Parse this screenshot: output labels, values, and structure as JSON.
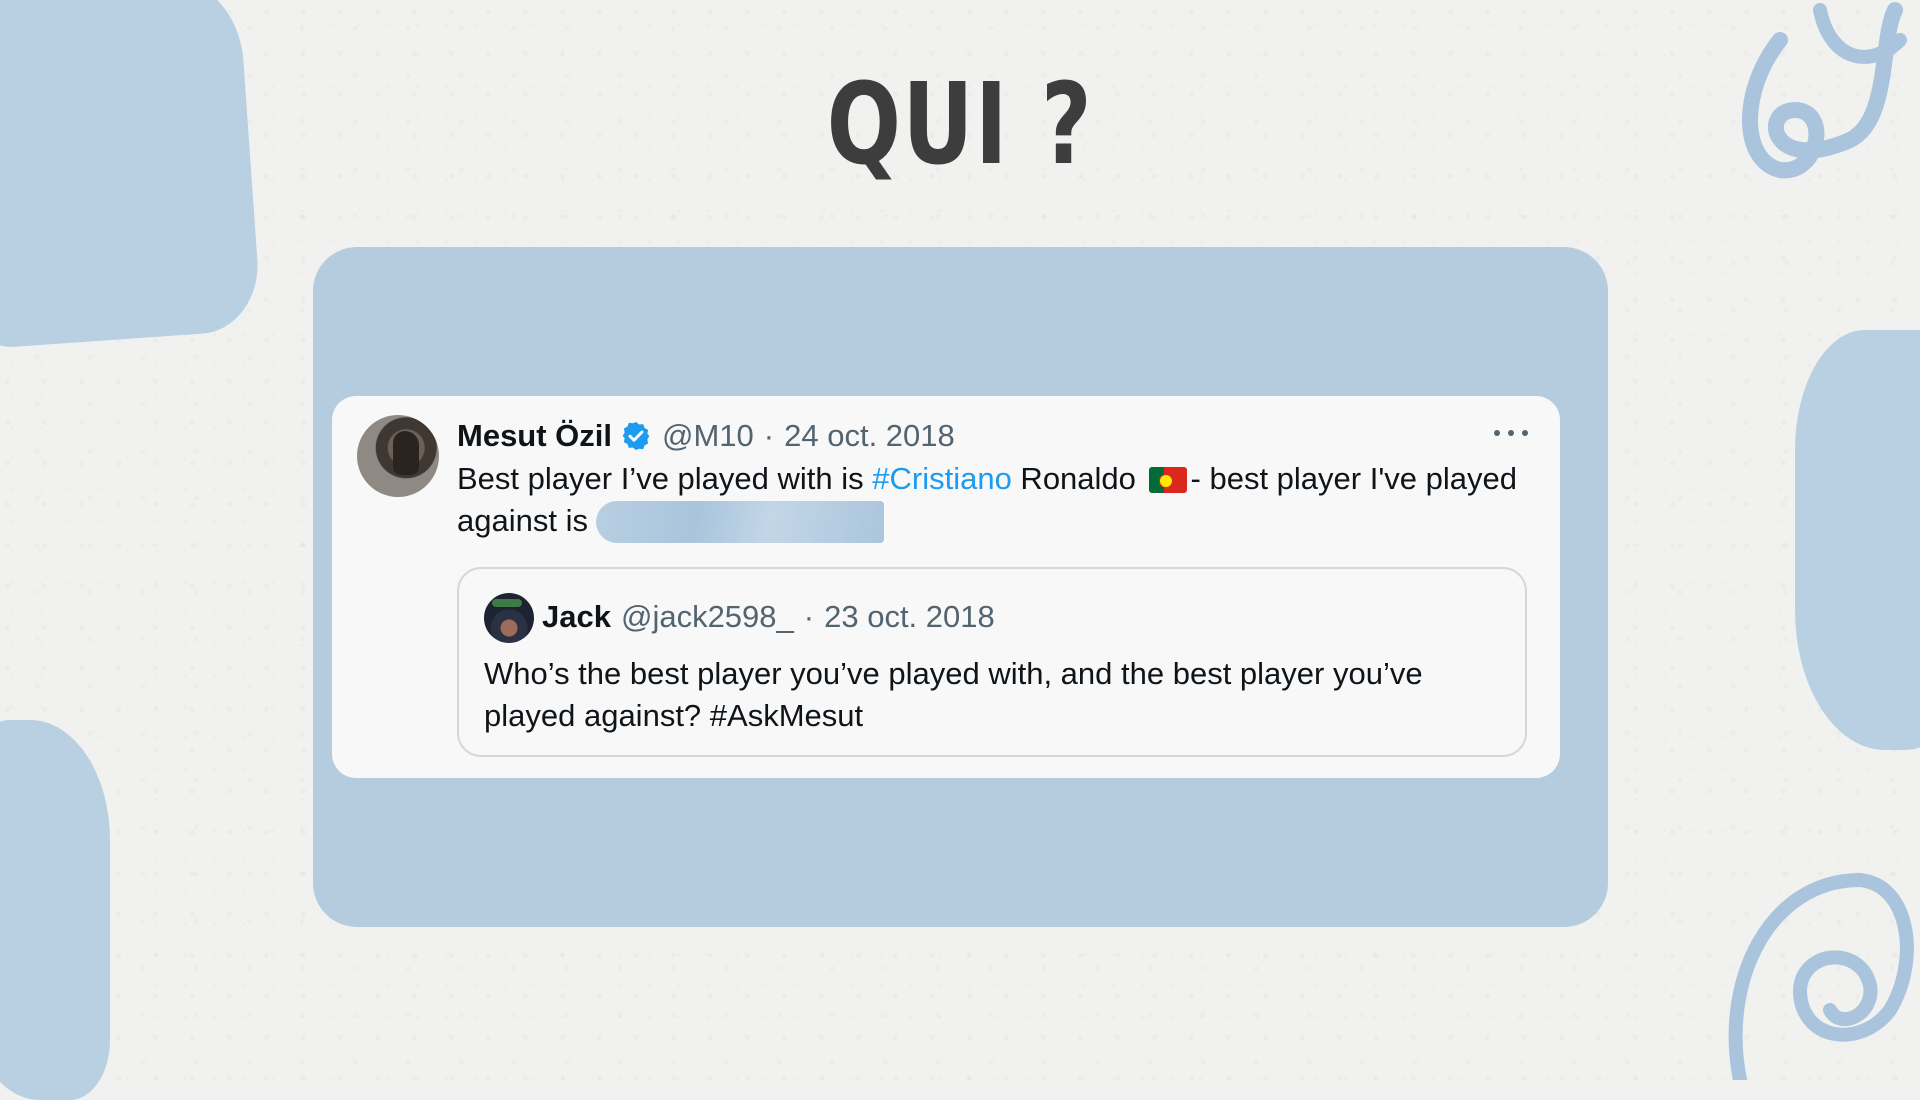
{
  "title": "QUI ?",
  "colors": {
    "panel": "#b5ccde",
    "card": "#f8f8f8",
    "hashtag": "#1d9bf0",
    "verified": "#1d9bf0",
    "muted_text": "#536471"
  },
  "tweet": {
    "author_name": "Mesut Özil",
    "verified_icon": "verified-badge-icon",
    "handle": "@M10",
    "separator": "·",
    "date": "24 oct. 2018",
    "more_icon": "more-dots-icon",
    "text_before_hashtag": "Best player I’ve played with is ",
    "hashtag": "#Cristiano",
    "text_after_hashtag": " Ronaldo ",
    "flag_icon": "portugal-flag-icon",
    "text_after_flag": "- best player I've played against is",
    "redacted": "redacted-answer"
  },
  "quoted_tweet": {
    "author_name": "Jack",
    "handle": "@jack2598_",
    "separator": "·",
    "date": "23 oct. 2018",
    "text": "Who’s the best player you’ve played with, and the best player you’ve played against? #AskMesut"
  }
}
